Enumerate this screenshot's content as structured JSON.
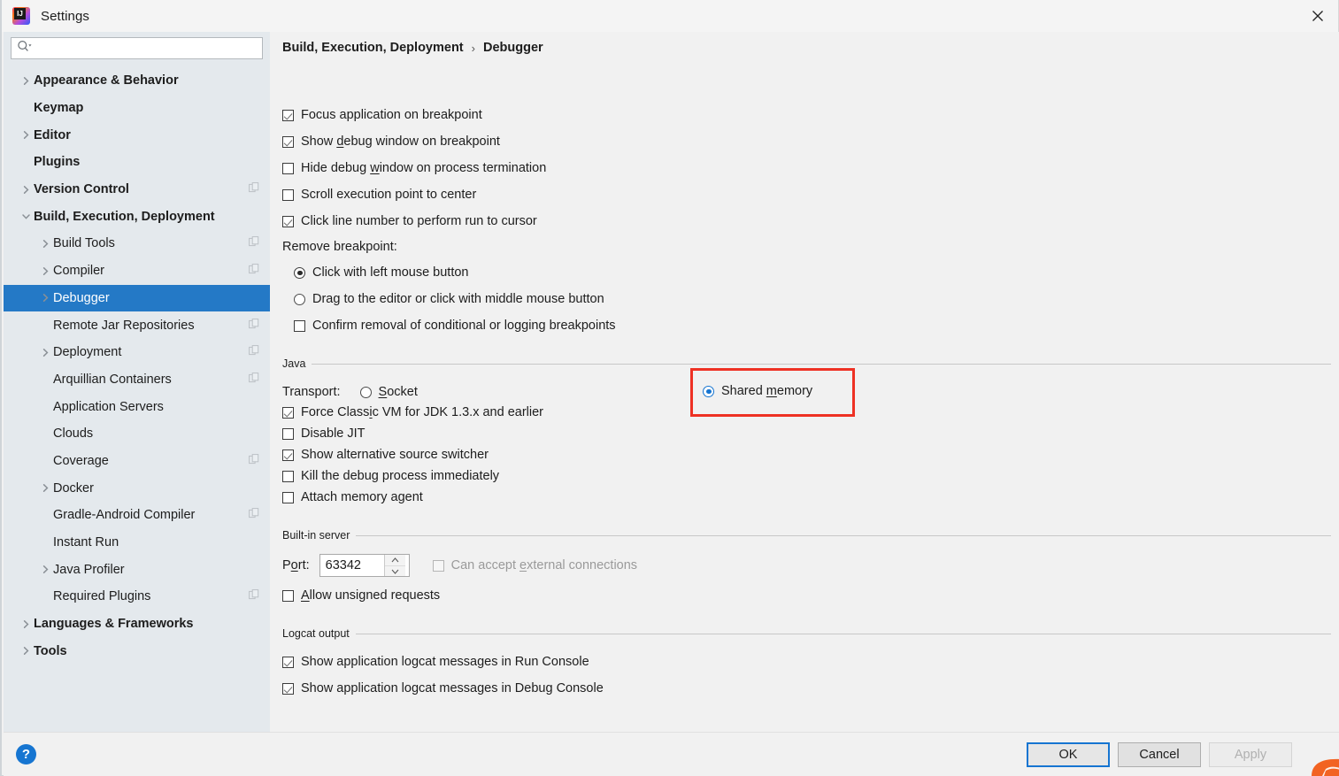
{
  "window": {
    "title": "Settings",
    "app_icon": "intellij-idea-icon",
    "close_icon": "close-icon"
  },
  "sidebar": {
    "search": {
      "placeholder": "",
      "value": "",
      "icon": "search-icon"
    },
    "items": [
      {
        "label": "Appearance & Behavior",
        "level": 0,
        "bold": true,
        "arrow": "chevron-right",
        "copy": false,
        "selected": false
      },
      {
        "label": "Keymap",
        "level": 0,
        "bold": true,
        "arrow": "none",
        "copy": false,
        "selected": false
      },
      {
        "label": "Editor",
        "level": 0,
        "bold": true,
        "arrow": "chevron-right",
        "copy": false,
        "selected": false
      },
      {
        "label": "Plugins",
        "level": 0,
        "bold": true,
        "arrow": "none",
        "copy": false,
        "selected": false
      },
      {
        "label": "Version Control",
        "level": 0,
        "bold": true,
        "arrow": "chevron-right",
        "copy": true,
        "selected": false
      },
      {
        "label": "Build, Execution, Deployment",
        "level": 0,
        "bold": true,
        "arrow": "chevron-down",
        "copy": false,
        "selected": false
      },
      {
        "label": "Build Tools",
        "level": 1,
        "bold": false,
        "arrow": "chevron-right",
        "copy": true,
        "selected": false
      },
      {
        "label": "Compiler",
        "level": 1,
        "bold": false,
        "arrow": "chevron-right",
        "copy": true,
        "selected": false
      },
      {
        "label": "Debugger",
        "level": 1,
        "bold": false,
        "arrow": "chevron-right",
        "copy": false,
        "selected": true
      },
      {
        "label": "Remote Jar Repositories",
        "level": 1,
        "bold": false,
        "arrow": "none",
        "copy": true,
        "selected": false
      },
      {
        "label": "Deployment",
        "level": 1,
        "bold": false,
        "arrow": "chevron-right",
        "copy": true,
        "selected": false
      },
      {
        "label": "Arquillian Containers",
        "level": 1,
        "bold": false,
        "arrow": "none",
        "copy": true,
        "selected": false
      },
      {
        "label": "Application Servers",
        "level": 1,
        "bold": false,
        "arrow": "none",
        "copy": false,
        "selected": false
      },
      {
        "label": "Clouds",
        "level": 1,
        "bold": false,
        "arrow": "none",
        "copy": false,
        "selected": false
      },
      {
        "label": "Coverage",
        "level": 1,
        "bold": false,
        "arrow": "none",
        "copy": true,
        "selected": false
      },
      {
        "label": "Docker",
        "level": 1,
        "bold": false,
        "arrow": "chevron-right",
        "copy": false,
        "selected": false
      },
      {
        "label": "Gradle-Android Compiler",
        "level": 1,
        "bold": false,
        "arrow": "none",
        "copy": true,
        "selected": false
      },
      {
        "label": "Instant Run",
        "level": 1,
        "bold": false,
        "arrow": "none",
        "copy": false,
        "selected": false
      },
      {
        "label": "Java Profiler",
        "level": 1,
        "bold": false,
        "arrow": "chevron-right",
        "copy": false,
        "selected": false
      },
      {
        "label": "Required Plugins",
        "level": 1,
        "bold": false,
        "arrow": "none",
        "copy": true,
        "selected": false
      },
      {
        "label": "Languages & Frameworks",
        "level": 0,
        "bold": true,
        "arrow": "chevron-right",
        "copy": false,
        "selected": false
      },
      {
        "label": "Tools",
        "level": 0,
        "bold": true,
        "arrow": "chevron-right",
        "copy": false,
        "selected": false
      }
    ],
    "selected_color": "#2479c6",
    "background": "#e4e9ed"
  },
  "breadcrumb": {
    "root": "Build, Execution, Deployment",
    "separator": "›",
    "leaf": "Debugger"
  },
  "general_options": [
    {
      "label_pre": "Focus application on breakpoint",
      "label_mn": "",
      "label_post": "",
      "checked": true
    },
    {
      "label_pre": "Show ",
      "label_mn": "d",
      "label_post": "ebug window on breakpoint",
      "checked": true
    },
    {
      "label_pre": "Hide debug ",
      "label_mn": "w",
      "label_post": "indow on process termination",
      "checked": false
    },
    {
      "label_pre": "Scroll execution point to center",
      "label_mn": "",
      "label_post": "",
      "checked": false
    },
    {
      "label_pre": "Click line number to perform run to cursor",
      "label_mn": "",
      "label_post": "",
      "checked": true
    }
  ],
  "remove_breakpoint": {
    "title": "Remove breakpoint:",
    "options": [
      {
        "label": "Click with left mouse button",
        "selected": true
      },
      {
        "label": "Drag to the editor or click with middle mouse button",
        "selected": false
      }
    ],
    "confirm": {
      "label": "Confirm removal of conditional or logging breakpoints",
      "checked": false
    }
  },
  "java": {
    "group_title": "Java",
    "transport_label": "Transport:",
    "transport_options": [
      {
        "label_pre": "",
        "label_mn": "S",
        "label_post": "ocket",
        "selected": false
      },
      {
        "label_pre": "Shared ",
        "label_mn": "m",
        "label_post": "emory",
        "selected": true
      }
    ],
    "options": [
      {
        "label_pre": "Force Class",
        "label_mn": "i",
        "label_post": "c VM for JDK 1.3.x and earlier",
        "checked": true
      },
      {
        "label_pre": "Disable JIT",
        "label_mn": "",
        "label_post": "",
        "checked": false
      },
      {
        "label_pre": "Show alternative source switcher",
        "label_mn": "",
        "label_post": "",
        "checked": true
      },
      {
        "label_pre": "Kill the debug process immediately",
        "label_mn": "",
        "label_post": "",
        "checked": false
      },
      {
        "label_pre": "Attach memory agent",
        "label_mn": "",
        "label_post": "",
        "checked": false
      }
    ]
  },
  "builtin_server": {
    "group_title": "Built-in server",
    "port_label_pre": "P",
    "port_label_mn": "o",
    "port_label_post": "rt:",
    "port_value": "63342",
    "external": {
      "label_pre": "Can accept ",
      "label_mn": "e",
      "label_post": "xternal connections",
      "checked": false,
      "disabled": true
    },
    "unsigned": {
      "label_pre": "",
      "label_mn": "A",
      "label_post": "llow unsigned requests",
      "checked": false
    }
  },
  "logcat": {
    "group_title": "Logcat output",
    "options": [
      {
        "label": "Show application logcat messages in Run Console",
        "checked": true
      },
      {
        "label": "Show application logcat messages in Debug Console",
        "checked": true
      }
    ]
  },
  "annotation": {
    "color": "#ee3124",
    "target": "Shared memory radio option"
  },
  "footer": {
    "help_label": "?",
    "ok_label": "OK",
    "cancel_label": "Cancel",
    "apply_label": "Apply"
  }
}
